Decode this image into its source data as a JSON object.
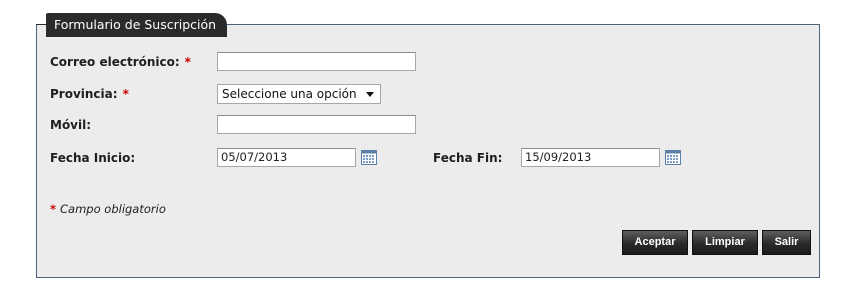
{
  "form": {
    "legend": "Formulario de Suscripción",
    "email": {
      "label": "Correo electrónico:",
      "required_mark": "*",
      "value": ""
    },
    "province": {
      "label": "Provincia:",
      "required_mark": "*",
      "selected": "Seleccione una opción"
    },
    "mobile": {
      "label": "Móvil:",
      "value": ""
    },
    "start_date": {
      "label": "Fecha Inicio:",
      "value": "05/07/2013"
    },
    "end_date": {
      "label": "Fecha Fin:",
      "value": "15/09/2013"
    },
    "required_note": {
      "mark": "*",
      "text": "Campo obligatorio"
    },
    "buttons": {
      "accept": "Aceptar",
      "clear": "Limpiar",
      "exit": "Salir"
    }
  },
  "icons": {
    "date_picker": "calendar-icon",
    "select_arrow": "chevron-down-icon"
  },
  "colors": {
    "legend_bg": "#2b2b2b",
    "panel_bg": "#ececec",
    "panel_border": "#4a6378",
    "required": "#cc0000",
    "button_bg": "#2a2a2a"
  }
}
